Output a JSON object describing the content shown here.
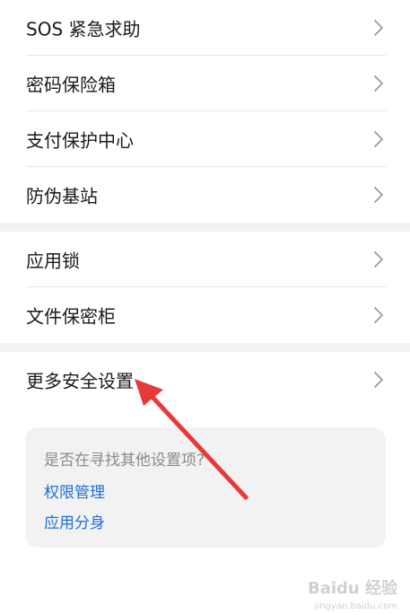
{
  "settings": {
    "group1": [
      {
        "label": "SOS 紧急求助"
      },
      {
        "label": "密码保险箱"
      },
      {
        "label": "支付保护中心"
      },
      {
        "label": "防伪基站"
      }
    ],
    "group2": [
      {
        "label": "应用锁"
      },
      {
        "label": "文件保密柜"
      }
    ],
    "group3": [
      {
        "label": "更多安全设置"
      }
    ]
  },
  "suggestion_card": {
    "question": "是否在寻找其他设置项?",
    "links": [
      {
        "label": "权限管理"
      },
      {
        "label": "应用分身"
      }
    ]
  },
  "watermark": {
    "brand": "Baidu 经验",
    "url": "jingyan.baidu.com"
  },
  "colors": {
    "link": "#1e6fd9",
    "arrow": "#e8393a",
    "section_gap": "#f3f3f3"
  },
  "icons": {
    "chevron": "chevron-right-icon"
  }
}
